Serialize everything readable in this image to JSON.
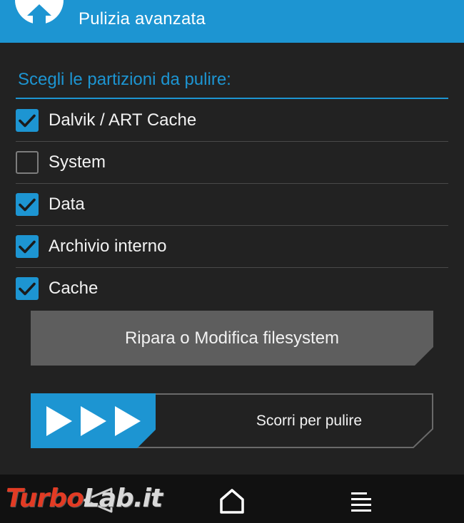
{
  "header": {
    "title": "Pulizia avanzata",
    "logo_icon": "twrp-logo-icon"
  },
  "section": {
    "title": "Scegli le partizioni da pulire:"
  },
  "partitions": [
    {
      "label": "Dalvik / ART Cache",
      "checked": true
    },
    {
      "label": "System",
      "checked": false
    },
    {
      "label": "Data",
      "checked": true
    },
    {
      "label": "Archivio interno",
      "checked": true
    },
    {
      "label": "Cache",
      "checked": true
    }
  ],
  "repair_button": {
    "label": "Ripara o Modifica filesystem"
  },
  "slider": {
    "label": "Scorri per pulire",
    "progress": 0
  },
  "navbar": {
    "back_icon": "back-icon",
    "home_icon": "home-icon",
    "menu_icon": "menu-icon"
  },
  "watermark": {
    "part_a": "Turbo",
    "part_b": "Lab.it"
  },
  "colors": {
    "accent": "#1d95d2",
    "background": "#222222",
    "button": "#5e5e5e",
    "navbar": "#111111",
    "text": "#f2f2f2",
    "watermark_red": "#e23b24"
  }
}
